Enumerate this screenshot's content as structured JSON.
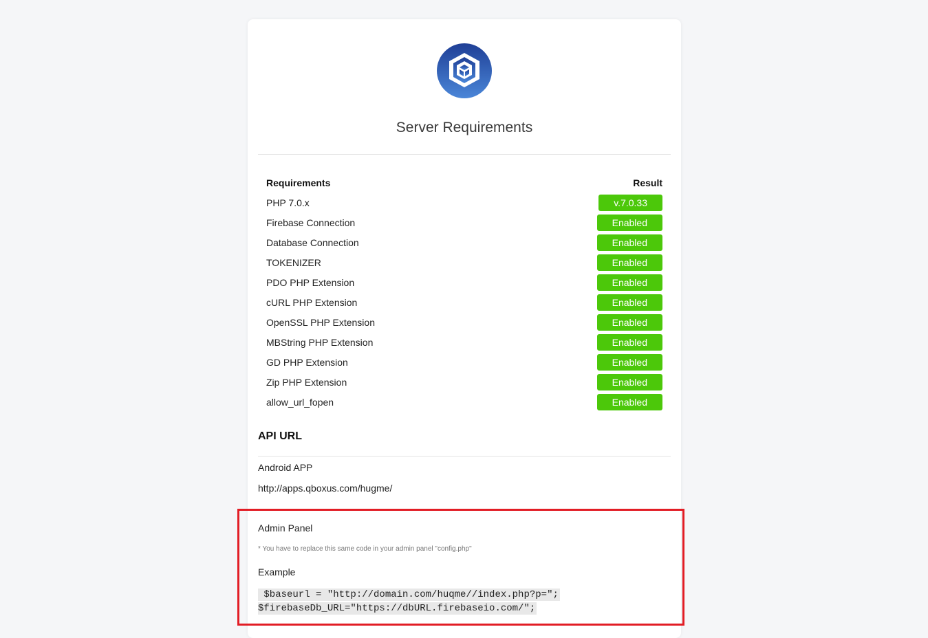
{
  "page": {
    "title": "Server Requirements",
    "logo_icon": "cube-logo-icon"
  },
  "colors": {
    "badge_green": "#4cc80a",
    "logo_blue": "#2f5fb3",
    "highlight_red": "#e21d25"
  },
  "requirements": {
    "header_left": "Requirements",
    "header_right": "Result",
    "rows": [
      {
        "name": "PHP 7.0.x",
        "result": "v.7.0.33"
      },
      {
        "name": "Firebase Connection",
        "result": "Enabled"
      },
      {
        "name": "Database Connection",
        "result": "Enabled"
      },
      {
        "name": "TOKENIZER",
        "result": "Enabled"
      },
      {
        "name": "PDO PHP Extension",
        "result": "Enabled"
      },
      {
        "name": "cURL PHP Extension",
        "result": "Enabled"
      },
      {
        "name": "OpenSSL PHP Extension",
        "result": "Enabled"
      },
      {
        "name": "MBString PHP Extension",
        "result": "Enabled"
      },
      {
        "name": "GD PHP Extension",
        "result": "Enabled"
      },
      {
        "name": "Zip PHP Extension",
        "result": "Enabled"
      },
      {
        "name": "allow_url_fopen",
        "result": "Enabled"
      }
    ]
  },
  "api": {
    "title": "API URL",
    "android_label": "Android APP",
    "android_url": "http://apps.qboxus.com/hugme/",
    "admin_label": "Admin Panel",
    "admin_note": "* You have to replace this same code in your admin panel \"config.php\"",
    "example_label": "Example",
    "code_line1": " $baseurl = \"http://domain.com/huqme//index.php?p=\";",
    "code_line2": "$firebaseDb_URL=\"https://dbURL.firebaseio.com/\";"
  }
}
